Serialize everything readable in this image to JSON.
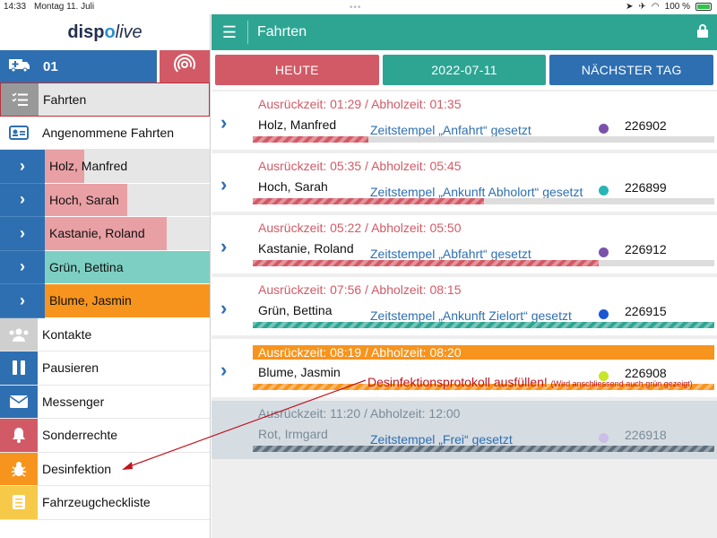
{
  "status_bar": {
    "time": "14:33",
    "date": "Montag 11. Juli",
    "battery": "100 %"
  },
  "sidebar": {
    "logo": {
      "part1": "disp",
      "part2": "o",
      "part3": "live"
    },
    "vehicle": {
      "label": "01"
    },
    "items": [
      {
        "label": "Fahrten",
        "icon": "list-icon",
        "color": "#999999",
        "active": true
      },
      {
        "label": "Angenommene Fahrten",
        "icon": "id-card-icon",
        "color": "#2e6fb1"
      }
    ],
    "rides": [
      {
        "label": "Holz, Manfred",
        "fill_color": "#e8a0a4",
        "progress": 0.24
      },
      {
        "label": "Hoch, Sarah",
        "fill_color": "#e8a0a4",
        "progress": 0.5
      },
      {
        "label": "Kastanie, Roland",
        "fill_color": "#e8a0a4",
        "progress": 0.74
      },
      {
        "label": "Grün, Bettina",
        "fill_color": "#7ecfc3",
        "progress": 1.0
      },
      {
        "label": "Blume, Jasmin",
        "fill_color": "#f7941d",
        "progress": 1.0
      }
    ],
    "bottom_items": [
      {
        "label": "Kontakte",
        "icon": "people-icon",
        "color": "#cfcfcf"
      },
      {
        "label": "Pausieren",
        "icon": "pause-icon",
        "color": "#2e6fb1"
      },
      {
        "label": "Messenger",
        "icon": "mail-icon",
        "color": "#2e6fb1"
      },
      {
        "label": "Sonderrechte",
        "icon": "bell-icon",
        "color": "#d25a66"
      },
      {
        "label": "Desinfektion",
        "icon": "bug-icon",
        "color": "#f7941d"
      },
      {
        "label": "Fahrzeugcheckliste",
        "icon": "checklist-icon",
        "color": "#f7c948"
      }
    ]
  },
  "topbar": {
    "title": "Fahrten"
  },
  "day_buttons": [
    {
      "label": "HEUTE",
      "color": "#d25a66"
    },
    {
      "label": "2022-07-11",
      "color": "#2ea593"
    },
    {
      "label": "NÄCHSTER TAG",
      "color": "#2e6fb1"
    }
  ],
  "rides": [
    {
      "times": "Ausrückzeit: 01:29 / Abholzeit: 01:35",
      "name": "Holz, Manfred",
      "status": "Zeitstempel „Anfahrt“ gesetzt",
      "dot_color": "#7b52ab",
      "number": "226902",
      "progress": 0.25,
      "bar_color": "#d25a66",
      "style": "normal"
    },
    {
      "times": "Ausrückzeit: 05:35 / Abholzeit: 05:45",
      "name": "Hoch, Sarah",
      "status": "Zeitstempel „Ankunft Abholort“ gesetzt",
      "dot_color": "#27b5b5",
      "number": "226899",
      "progress": 0.5,
      "bar_color": "#d25a66",
      "style": "normal"
    },
    {
      "times": "Ausrückzeit: 05:22 / Abholzeit: 05:50",
      "name": "Kastanie, Roland",
      "status": "Zeitstempel „Abfahrt“ gesetzt",
      "dot_color": "#7b52ab",
      "number": "226912",
      "progress": 0.75,
      "bar_color": "#d25a66",
      "style": "normal"
    },
    {
      "times": "Ausrückzeit: 07:56 / Abholzeit: 08:15",
      "name": "Grün, Bettina",
      "status": "Zeitstempel „Ankunft Zielort“ gesetzt",
      "dot_color": "#1a56d6",
      "number": "226915",
      "progress": 1.0,
      "bar_color": "#2ea593",
      "style": "normal"
    },
    {
      "times": "Ausrückzeit: 08:19 / Abholzeit: 08:20",
      "name": "Blume, Jasmin",
      "status": "",
      "dot_color": "#c8e62a",
      "number": "226908",
      "progress": 1.0,
      "bar_color": "#f7941d",
      "style": "orange"
    },
    {
      "times": "Ausrückzeit: 11:20 / Abholzeit: 12:00",
      "name": "Rot, Irmgard",
      "status": "Zeitstempel „Frei“ gesetzt",
      "dot_color": "#cbbfe8",
      "number": "226918",
      "progress": 1.0,
      "bar_color": "#5e6f7c",
      "style": "inactive"
    }
  ],
  "annotation": {
    "main": "Desinfektionsprotokoll ausfüllen!",
    "note": "(Wird anschliessend auch grün gezeigt)",
    "color": "#c0141e"
  }
}
